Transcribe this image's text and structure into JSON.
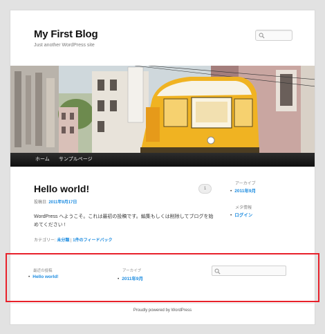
{
  "site": {
    "title": "My First Blog",
    "description": "Just another WordPress site"
  },
  "header_search": {
    "placeholder": ""
  },
  "nav": {
    "items": [
      {
        "label": "ホーム"
      },
      {
        "label": "サンプルページ"
      }
    ]
  },
  "post": {
    "title": "Hello world!",
    "comment_count": "1",
    "meta_prefix": "投稿日: ",
    "meta_date": "2011年9月17日",
    "body": "WordPress へようこそ。これは最初の投稿です。編集もしくは削除してブログを始めてください !",
    "categories_prefix": "カテゴリー: ",
    "category_1": "未分類",
    "categories_sep": " | ",
    "comment_link": "1件のフィードバック"
  },
  "sidebar": {
    "archive_title": "アーカイブ",
    "archive_item": "2011年9月",
    "meta_title": "メタ情報",
    "meta_item": "ログイン"
  },
  "footer_widgets": {
    "recent_title": "最近の投稿",
    "recent_item": "Hello world!",
    "archive_title": "アーカイブ",
    "archive_item": "2011年9月",
    "search_placeholder": ""
  },
  "credits": "Proudly powered by WordPress",
  "colors": {
    "link": "#1b8be0",
    "nav_bg": "#1a1a1a",
    "highlight_border": "#e8202a",
    "page_bg": "#e2e2e2",
    "tram_yellow": "#f0b322"
  },
  "icons": [
    "search-icon",
    "comment-bubble-icon"
  ]
}
